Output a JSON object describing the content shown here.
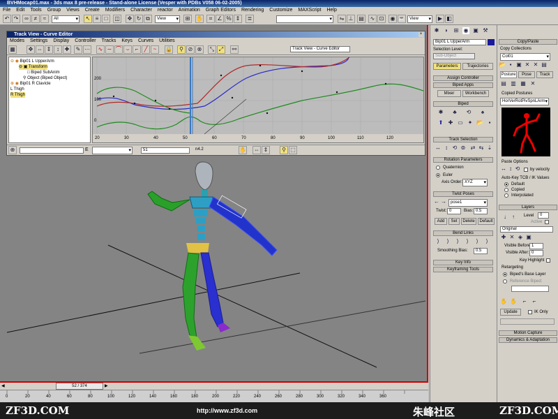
{
  "window": {
    "title": "BVHMocap01.max - 3ds max 8 pre-release - Stand-alone License (Vesper with PDBs V058 06-02-2005)"
  },
  "menu": [
    "File",
    "Edit",
    "Tools",
    "Group",
    "Views",
    "Create",
    "Modifiers",
    "Character",
    "reactor",
    "Animation",
    "Graph Editors",
    "Rendering",
    "Customize",
    "MAXScript",
    "Help"
  ],
  "toolbar": {
    "selection_filter": "All",
    "view1": "View",
    "view2": "View"
  },
  "trackview": {
    "title": "Track View - Curve Editor",
    "menu": [
      "Modes",
      "Settings",
      "Display",
      "Controller",
      "Tracks",
      "Keys",
      "Curves",
      "Utilities"
    ],
    "name_field": "Track View - Curve Editor",
    "tree": [
      "Bip01 L UpperArm",
      "Transform",
      "Biped SubAnim",
      "Object (Biped Object)",
      "Bip01 R Clavicle",
      "L Thigh",
      "R Thigh"
    ],
    "y_ticks": [
      "200",
      "100",
      "0",
      "20"
    ],
    "x_ticks": [
      "20",
      "30",
      "40",
      "50",
      "60",
      "70",
      "80",
      "90",
      "100",
      "110",
      "120"
    ],
    "bottom_value": "51",
    "bottom_label": "E",
    "zoom_text": "n4.2"
  },
  "timeline": {
    "frame": "52 / 374"
  },
  "trackbar": {
    "ticks": [
      "0",
      "20",
      "40",
      "60",
      "80",
      "100",
      "120",
      "140",
      "160",
      "180",
      "200",
      "220",
      "240",
      "260",
      "280",
      "300",
      "320",
      "340",
      "360"
    ]
  },
  "footer": {
    "left": "ZF3D.COM",
    "url": "http://www.zf3d.com",
    "cn": "朱峰社区",
    "right": "ZF3D.COM"
  },
  "cmd": {
    "name": "Bip01 L UpperArm",
    "sel_level": "Selection Level:",
    "sub_object": "Sub-Object",
    "tabs": [
      "Parameters",
      "Trajectories"
    ],
    "rollouts": [
      "Assign Controller",
      "Biped Apps",
      "Biped",
      "Track Selection",
      "Rotation Parameters",
      "Twist Poses",
      "Bend Links",
      "Key Info",
      "Keyframing Tools"
    ],
    "mixer": "Mixer",
    "workbench": "Workbench",
    "quaternion": "Quaternion",
    "euler": "Euler",
    "axis_order_label": "Axis Order:",
    "axis_order": "XYZ",
    "pose": "pose1",
    "twist": "Twist:",
    "twist_val": "0",
    "bias": "Bias:",
    "bias_val": "0.5",
    "pose_buttons": [
      "Add",
      "Set",
      "Delete",
      "Default"
    ],
    "smoothing_label": "Smoothing Bias:",
    "smoothing_val": "0.5"
  },
  "copypaste": {
    "title": "Copy/Paste",
    "collections": "Copy Collections",
    "collection": "Col01",
    "tabs": [
      "Posture",
      "Pose",
      "Track"
    ],
    "copied": "Copied Postures",
    "posture": "HorVerRotPivSpnLArm",
    "paste_options": "Paste Options",
    "by_velocity": "by velocity",
    "autokey": "Auto-Key TCB / IK Values",
    "ak_options": [
      "Default",
      "Copied",
      "Interpolated"
    ],
    "layers": "Layers",
    "level": "Level",
    "level_val": "0",
    "active": "Active",
    "original": "Original",
    "visible_before": "Visible Before:",
    "vb_val": "1",
    "visible_after": "Visible After:",
    "va_val": "0",
    "key_highlight": "Key Highlight",
    "retargeting": "Retargeting",
    "base_layer": "Biped's Base Layer",
    "ref_biped": "Reference Biped:",
    "update": "Update",
    "ik_only": "IK Only",
    "motion_capture": "Motion Capture",
    "dynamics": "Dynamics & Adaptation"
  }
}
